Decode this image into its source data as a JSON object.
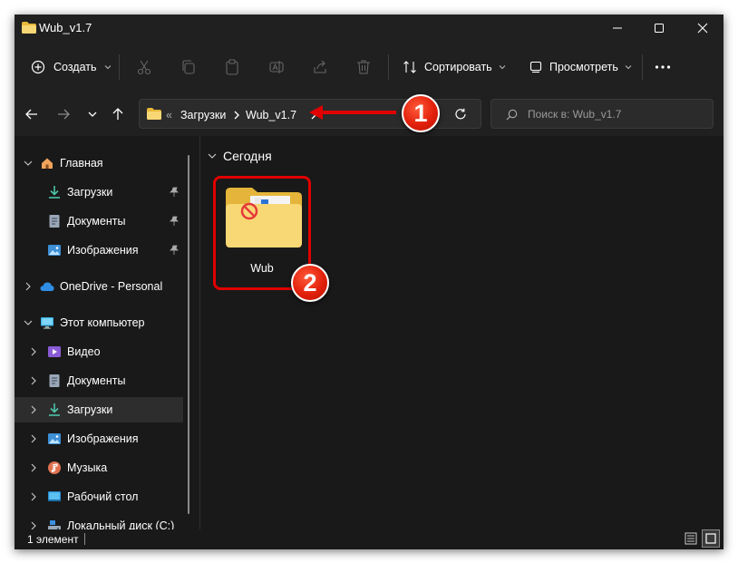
{
  "window": {
    "title": "Wub_v1.7"
  },
  "toolbar": {
    "create_label": "Создать",
    "sort_label": "Сортировать",
    "view_label": "Просмотреть"
  },
  "address": {
    "overflow": "«",
    "crumbs": [
      "Загрузки",
      "Wub_v1.7"
    ],
    "search_placeholder": "Поиск в: Wub_v1.7"
  },
  "sidebar": {
    "quick_access": "Главная",
    "pinned": [
      "Загрузки",
      "Документы",
      "Изображения"
    ],
    "onedrive": "OneDrive - Personal",
    "this_pc": "Этот компьютер",
    "pc_items": [
      "Видео",
      "Документы",
      "Загрузки",
      "Изображения",
      "Музыка",
      "Рабочий стол",
      "Локальный диск (C:)"
    ]
  },
  "content": {
    "group": "Сегодня",
    "items": [
      {
        "name": "Wub"
      }
    ]
  },
  "status": {
    "count": "1 элемент"
  },
  "callouts": [
    "1",
    "2"
  ],
  "colors": {
    "accent_red": "#e00000",
    "folder_yellow": "#f8d775",
    "background": "#191919"
  }
}
